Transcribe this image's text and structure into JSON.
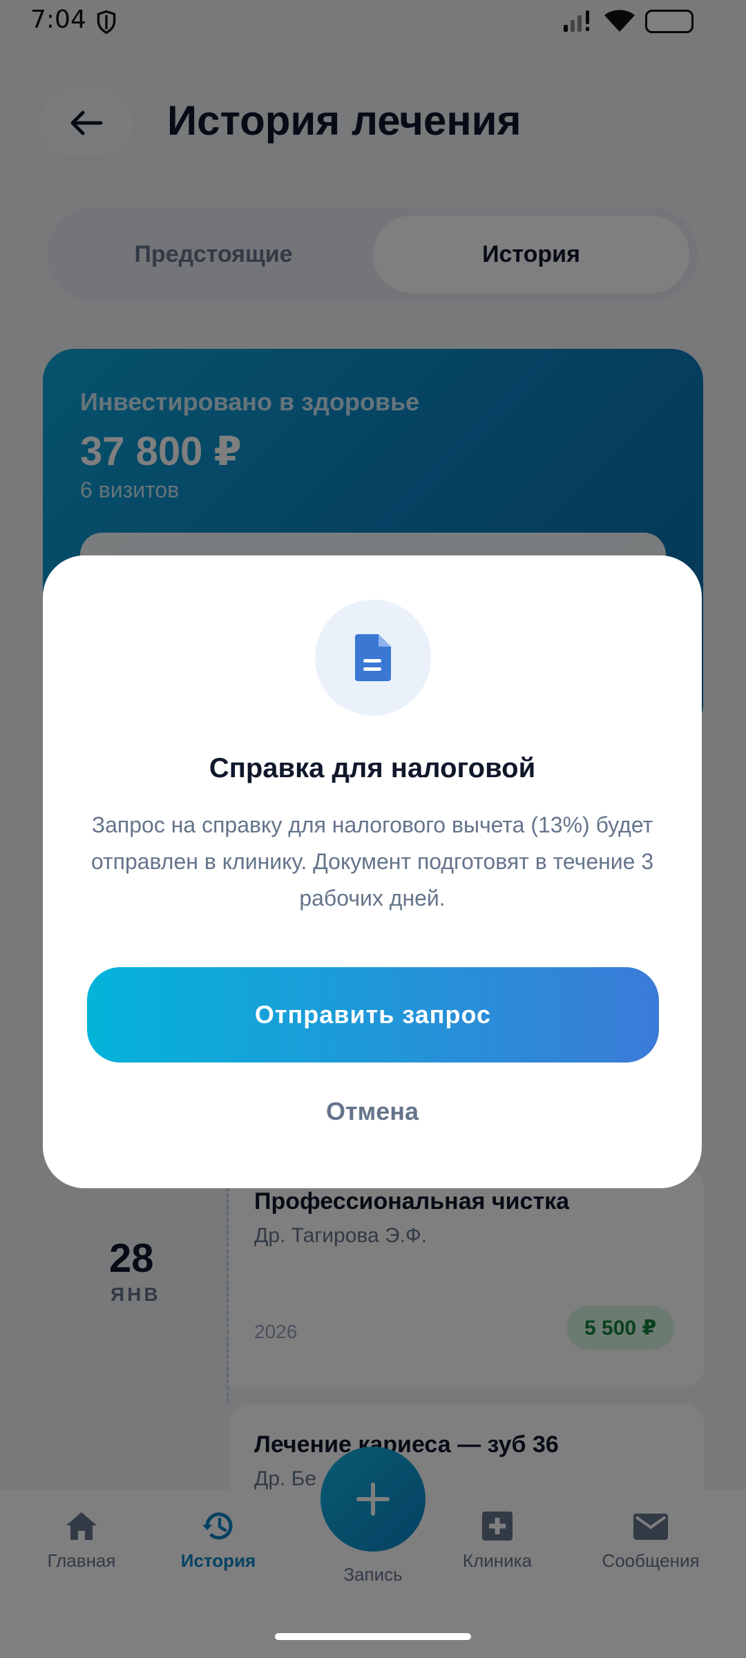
{
  "status_bar": {
    "time": "7:04"
  },
  "header": {
    "title": "История лечения"
  },
  "tabs": [
    {
      "label": "Предстоящие"
    },
    {
      "label": "История"
    }
  ],
  "summary": {
    "label": "Инвестировано в здоровье",
    "amount": "37 800 ₽",
    "visits": "6 визитов"
  },
  "visits": [
    {
      "day": "28",
      "month": "ЯНВ",
      "title": "Профессиональная чистка",
      "doctor": "Др. Тагирова Э.Ф.",
      "year": "2026",
      "price": "5 500 ₽"
    },
    {
      "title": "Лечение кариеса — зуб 36",
      "doctor": "Др. Бе"
    }
  ],
  "bottom_nav": {
    "items": [
      {
        "label": "Главная",
        "icon": "home-icon"
      },
      {
        "label": "История",
        "icon": "history-icon"
      },
      {
        "label": "Клиника",
        "icon": "clinic-icon"
      },
      {
        "label": "Сообщения",
        "icon": "mail-icon"
      }
    ],
    "fab_label": "Запись"
  },
  "dialog": {
    "icon": "document-icon",
    "title": "Справка для налоговой",
    "text": "Запрос на справку для налогового вычета (13%) будет отправлен в клинику. Документ подготовят в течение 3 рабочих дней.",
    "primary": "Отправить запрос",
    "cancel": "Отмена"
  },
  "colors": {
    "accent": "#0b84c6",
    "primary_gradient_start": "#04b4d9",
    "primary_gradient_end": "#3b7bd8",
    "price_bg": "#d9f7e5",
    "price_text": "#15803d"
  }
}
